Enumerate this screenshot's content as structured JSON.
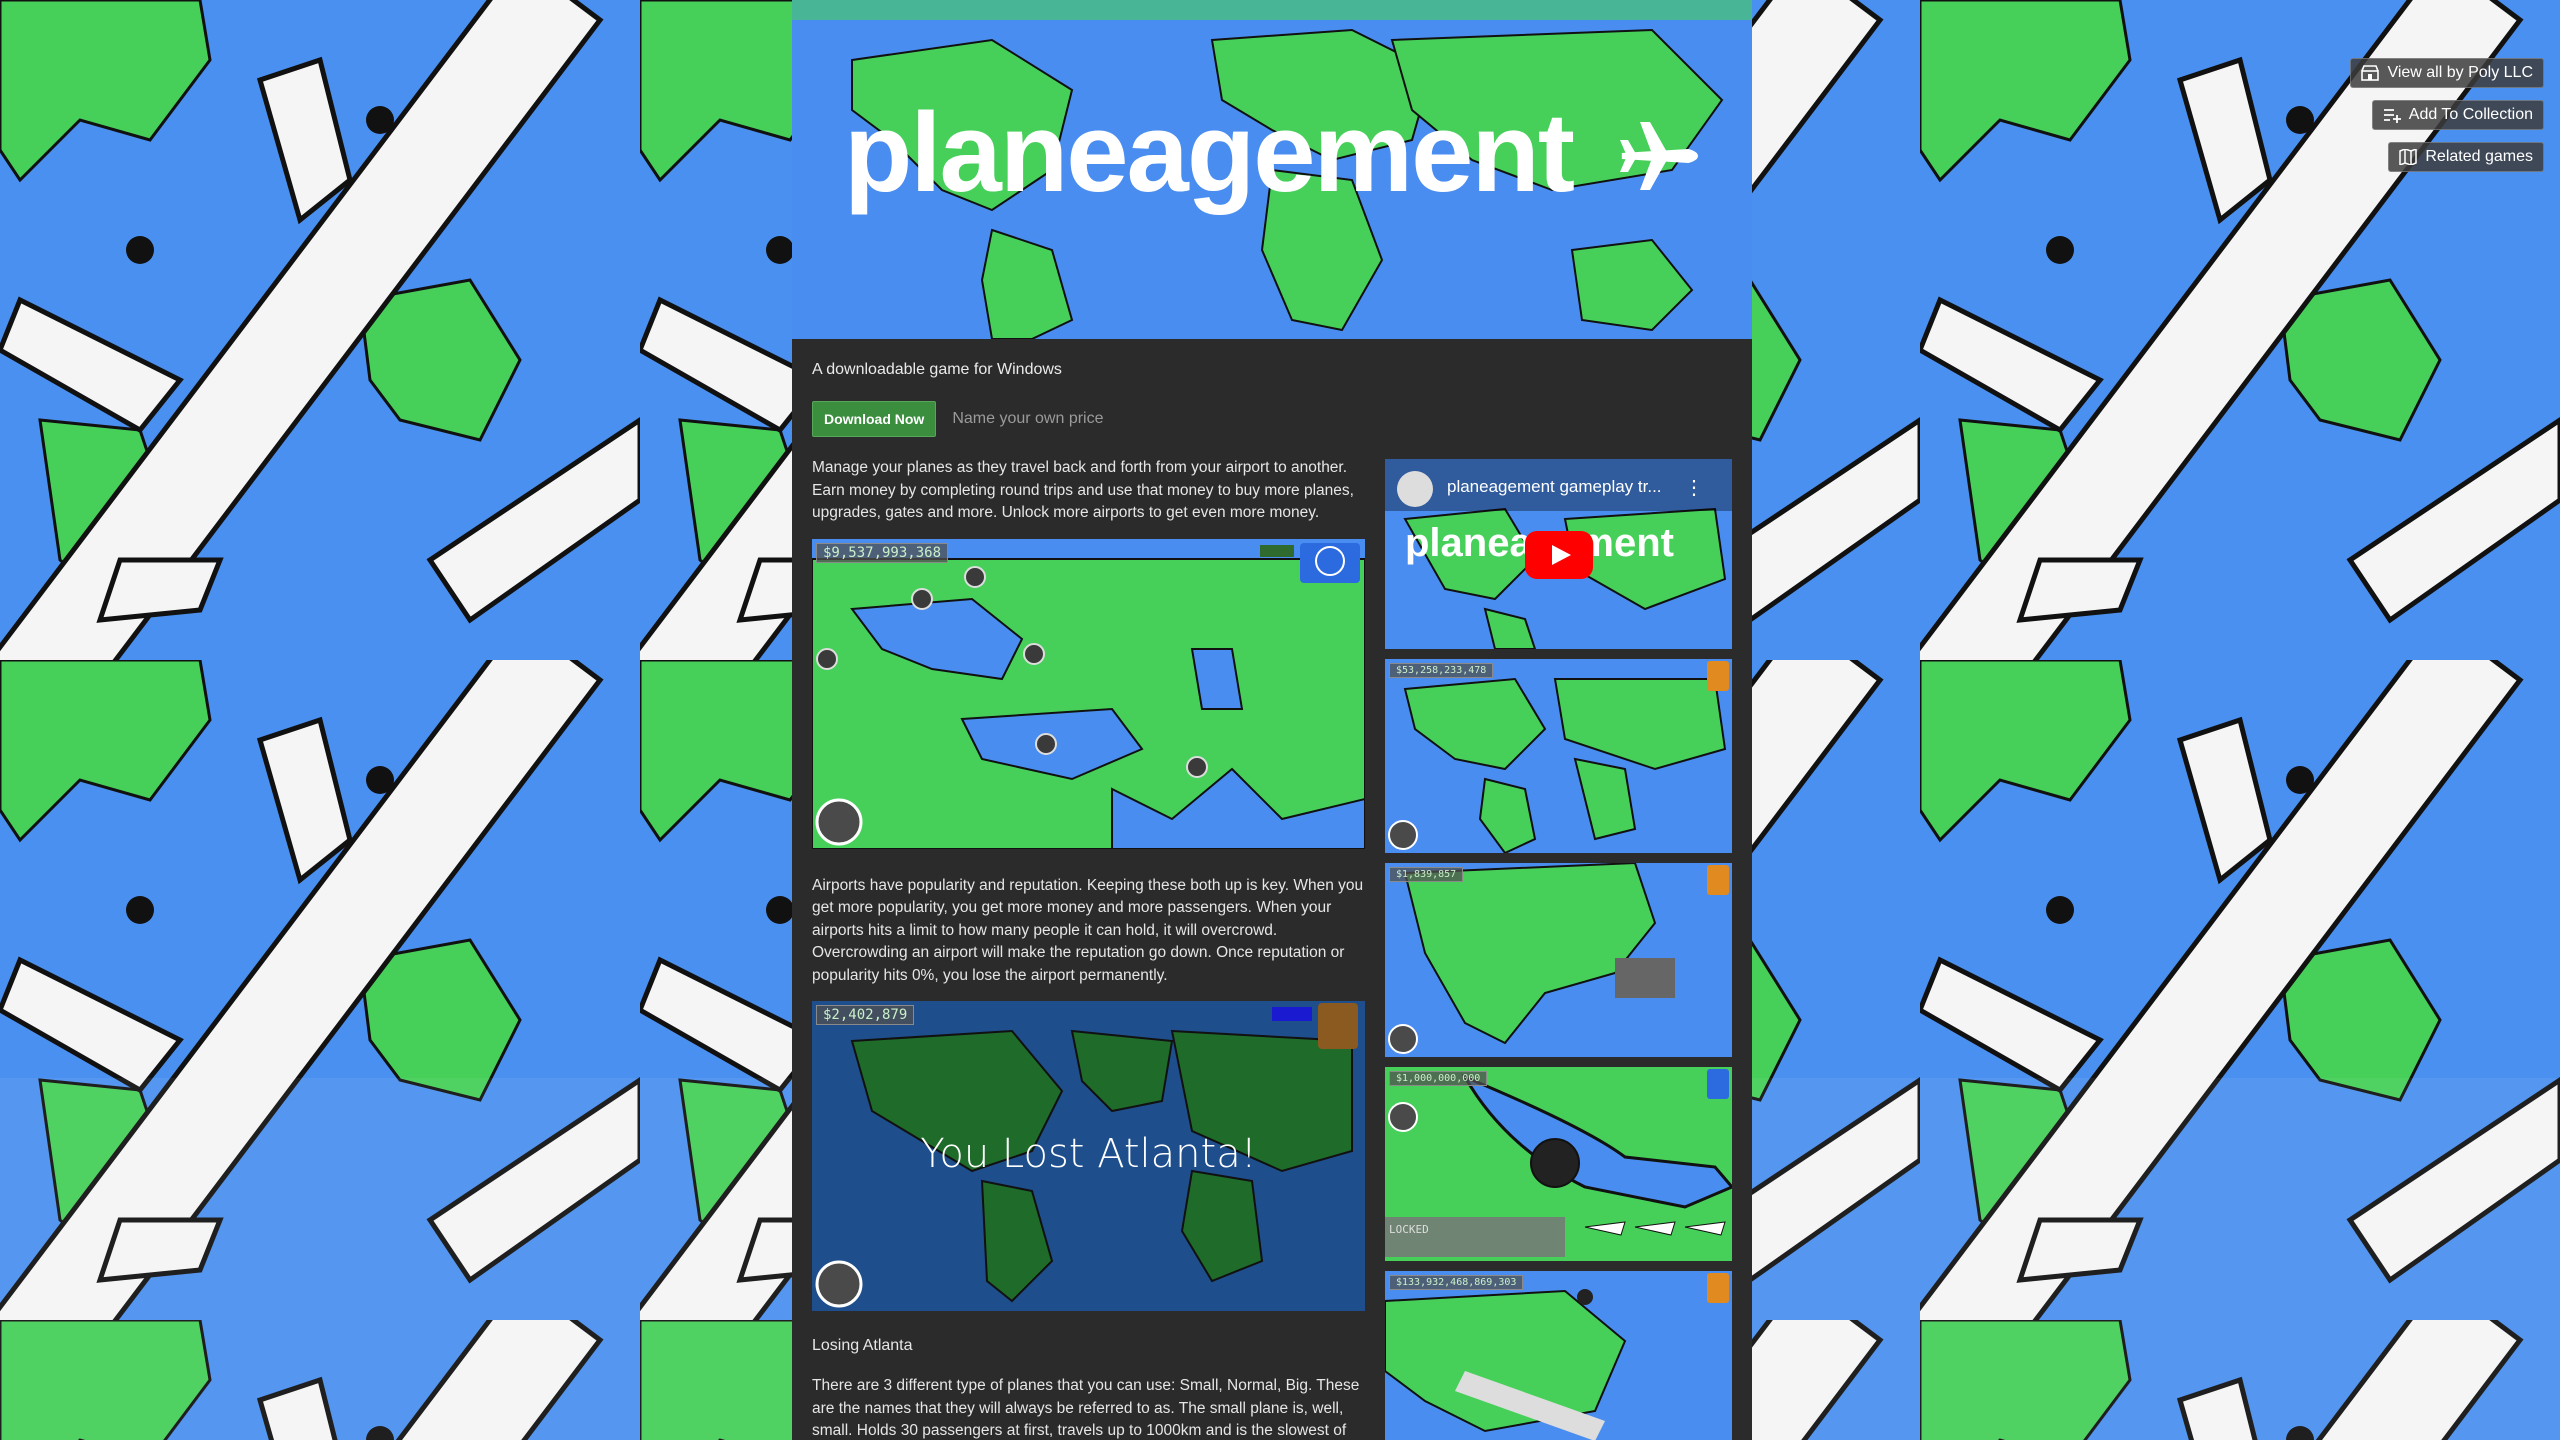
{
  "toolbar": {
    "view_all": "View all by Poly LLC",
    "add_collection": "Add To Collection",
    "related": "Related games"
  },
  "header": {
    "title": "planeagement"
  },
  "page": {
    "tagline": "A downloadable game for Windows",
    "download_label": "Download Now",
    "price_hint": "Name your own price",
    "para1": "Manage your planes as they travel back and forth from your airport to another. Earn money by completing round trips and use that money to buy more planes, upgrades, gates and more. Unlock more airports to get even more money.",
    "para2": "Airports have popularity and reputation. Keeping these both up is key. When you get more popularity, you get more money and more passengers. When your airports hits a limit to how many people it can hold, it will overcrowd. Overcrowding an airport will make the reputation go down. Once reputation or popularity hits 0%, you lose the airport permanently.",
    "caption": "Losing Atlanta",
    "para3": "There are 3 different type of planes that you can use: Small, Normal, Big. These are the names that they will always be referred to as. The small plane is, well, small. Holds 30 passengers at first, travels up to 1000km and is the slowest of"
  },
  "screens": {
    "shot1_money": "$9,537,993,368",
    "shot2_money": "$2,402,879",
    "shot2_lost": "You Lost Atlanta!",
    "thumb1_money": "$53,258,233,478",
    "thumb2_money": "$1,839,857",
    "thumb3_money": "$1,000,000,000",
    "thumb3_locked": "LOCKED",
    "thumb4_money": "$133,932,468,869,303"
  },
  "video": {
    "title": "planeagement gameplay tr...",
    "thumb_title": "planeagement"
  },
  "colors": {
    "accent_green": "#3b8e3e",
    "sky_blue": "#4a8df0",
    "land_green": "#46d05a",
    "panel": "#2b2b2b"
  }
}
